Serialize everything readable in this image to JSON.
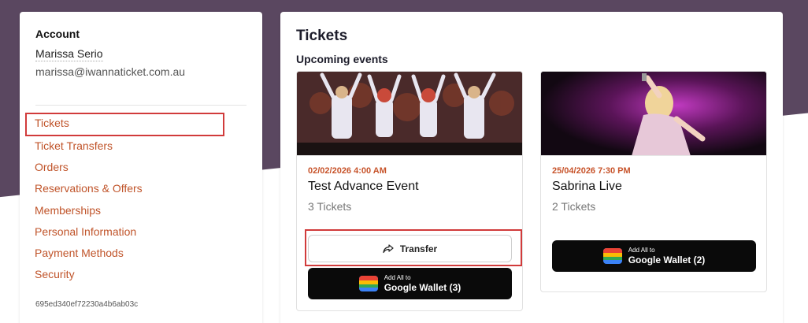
{
  "sidebar": {
    "heading": "Account",
    "user_name": "Marissa Serio",
    "user_email": "marissa@iwannaticket.com.au",
    "nav": [
      {
        "label": "Tickets"
      },
      {
        "label": "Ticket Transfers"
      },
      {
        "label": "Orders"
      },
      {
        "label": "Reservations & Offers"
      },
      {
        "label": "Memberships"
      },
      {
        "label": "Personal Information"
      },
      {
        "label": "Payment Methods"
      },
      {
        "label": "Security"
      }
    ],
    "user_id": "695ed340ef72230a4b6ab03c"
  },
  "main": {
    "title": "Tickets",
    "section": "Upcoming events",
    "events": [
      {
        "date": "02/02/2026 4:00 AM",
        "name": "Test Advance Event",
        "tickets": "3 Tickets",
        "transfer_label": "Transfer",
        "wallet_small": "Add All to",
        "wallet_big": "Google Wallet (3)"
      },
      {
        "date": "25/04/2026 7:30 PM",
        "name": "Sabrina Live",
        "tickets": "2 Tickets",
        "wallet_small": "Add All to",
        "wallet_big": "Google Wallet (2)"
      }
    ]
  },
  "colors": {
    "accent": "#c0542a",
    "highlight": "#d13b3b",
    "header_bg": "#5a4760"
  },
  "icons": {
    "transfer": "share-forward-icon",
    "wallet": "google-wallet-icon"
  }
}
